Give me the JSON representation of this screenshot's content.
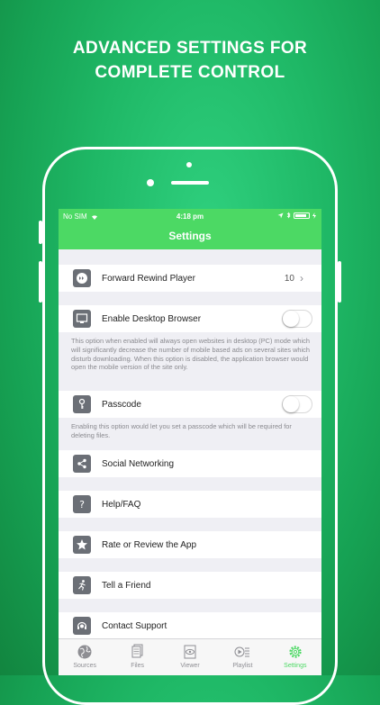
{
  "headline": {
    "line1": "ADVANCED SETTINGS FOR",
    "line2": "COMPLETE CONTROL"
  },
  "status_bar": {
    "carrier": "No SIM",
    "time": "4:18 pm"
  },
  "nav": {
    "title": "Settings"
  },
  "settings": {
    "forward_rewind": {
      "label": "Forward Rewind Player",
      "value": "10"
    },
    "desktop_browser": {
      "label": "Enable Desktop Browser",
      "enabled": false,
      "description": "This option when enabled will always open websites in desktop (PC) mode which will significantly decrease the number of mobile based ads on several sites which disturb downloading. When this option is disabled, the application browser would open the mobile version of the site only."
    },
    "passcode": {
      "label": "Passcode",
      "enabled": false,
      "description": "Enabling this option would let you set a passcode which will be required for deleting files."
    },
    "social": {
      "label": "Social Networking"
    },
    "help": {
      "label": "Help/FAQ"
    },
    "rate": {
      "label": "Rate or Review the App"
    },
    "tell": {
      "label": "Tell a Friend"
    },
    "support": {
      "label": "Contact Support"
    }
  },
  "tabs": [
    {
      "label": "Sources",
      "icon": "globe-icon"
    },
    {
      "label": "Files",
      "icon": "files-icon"
    },
    {
      "label": "Viewer",
      "icon": "viewer-icon"
    },
    {
      "label": "Playlist",
      "icon": "playlist-icon"
    },
    {
      "label": "Settings",
      "icon": "gear-icon",
      "active": true
    }
  ],
  "colors": {
    "accent_green": "#4cd964",
    "icon_gray": "#6b6f76",
    "background_gray": "#efeff4"
  }
}
